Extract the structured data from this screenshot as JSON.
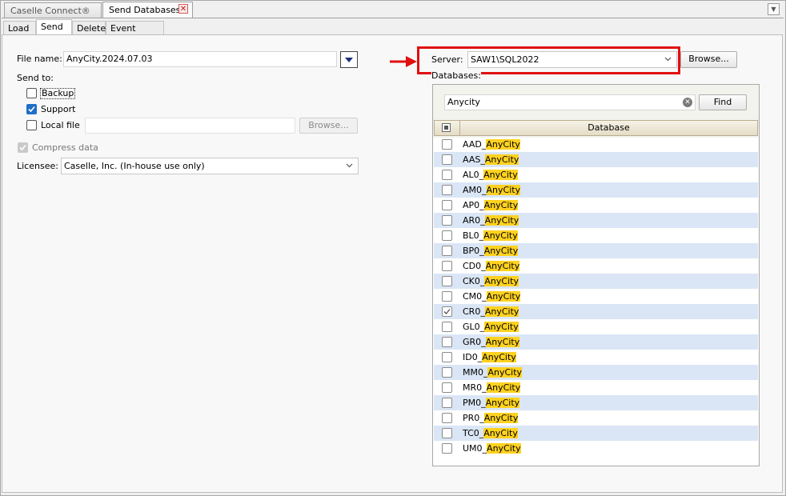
{
  "tabs": {
    "caselle": "Caselle Connect®",
    "send_db": "Send Databases"
  },
  "subtabs": [
    "Load",
    "Send",
    "Delete",
    "Event Viewer"
  ],
  "form": {
    "file_name_label": "File name:",
    "file_name_value": "AnyCity.2024.07.03",
    "send_to_label": "Send to:",
    "backup_label": "Backup",
    "backup_checked": false,
    "support_label": "Support",
    "support_checked": true,
    "local_file_label": "Local file",
    "local_file_checked": false,
    "local_file_value": "",
    "browse_label": "Browse...",
    "compress_label": "Compress data",
    "compress_checked": true,
    "licensee_label": "Licensee:",
    "licensee_value": "Caselle, Inc. (In-house use only)"
  },
  "server": {
    "label": "Server:",
    "value": "SAW1\\SQL2022",
    "browse_label": "Browse..."
  },
  "databases": {
    "label": "Databases:",
    "search_value": "Anycity",
    "find_label": "Find",
    "column_header": "Database",
    "highlight_color": "#ffd21f",
    "rows": [
      {
        "prefix": "AAD_",
        "match": "AnyCity",
        "checked": false
      },
      {
        "prefix": "AAS_",
        "match": "AnyCity",
        "checked": false
      },
      {
        "prefix": "AL0_",
        "match": "AnyCity",
        "checked": false
      },
      {
        "prefix": "AM0_",
        "match": "AnyCity",
        "checked": false
      },
      {
        "prefix": "AP0_",
        "match": "AnyCity",
        "checked": false
      },
      {
        "prefix": "AR0_",
        "match": "AnyCity",
        "checked": false
      },
      {
        "prefix": "BL0_",
        "match": "AnyCity",
        "checked": false
      },
      {
        "prefix": "BP0_",
        "match": "AnyCity",
        "checked": false
      },
      {
        "prefix": "CD0_",
        "match": "AnyCity",
        "checked": false
      },
      {
        "prefix": "CK0_",
        "match": "AnyCity",
        "checked": false
      },
      {
        "prefix": "CM0_",
        "match": "AnyCity",
        "checked": false
      },
      {
        "prefix": "CR0_",
        "match": "AnyCity",
        "checked": true
      },
      {
        "prefix": "GL0_",
        "match": "AnyCity",
        "checked": false
      },
      {
        "prefix": "GR0_",
        "match": "AnyCity",
        "checked": false
      },
      {
        "prefix": "ID0_",
        "match": "AnyCity",
        "checked": false
      },
      {
        "prefix": "MM0_",
        "match": "AnyCity",
        "checked": false
      },
      {
        "prefix": "MR0_",
        "match": "AnyCity",
        "checked": false
      },
      {
        "prefix": "PM0_",
        "match": "AnyCity",
        "checked": false
      },
      {
        "prefix": "PR0_",
        "match": "AnyCity",
        "checked": false
      },
      {
        "prefix": "TC0_",
        "match": "AnyCity",
        "checked": false
      },
      {
        "prefix": "UM0_",
        "match": "AnyCity",
        "checked": false
      }
    ]
  },
  "annotation": {
    "arrow_color": "#e01010",
    "box_color": "#e01010"
  }
}
